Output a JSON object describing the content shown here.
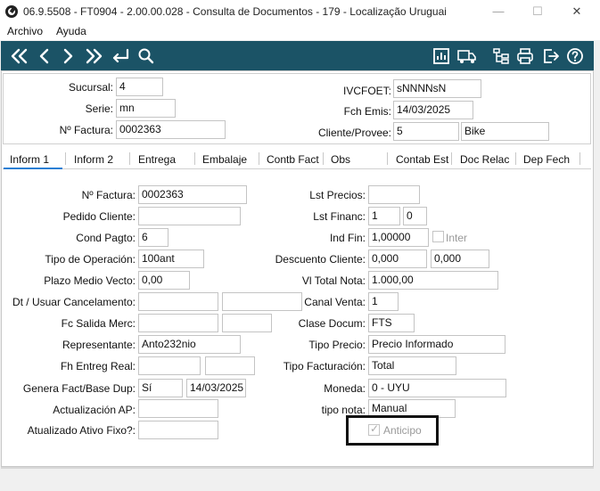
{
  "window": {
    "title": "06.9.5508 - FT0904 - 2.00.00.028 - Consulta de Documentos - 179 - Localização Uruguai",
    "minimize_glyph": "—",
    "maximize_glyph": "☐",
    "close_glyph": "✕"
  },
  "menu": {
    "items": [
      "Archivo",
      "Ayuda"
    ]
  },
  "toolbar": {
    "left_icons": [
      "first-record-icon",
      "previous-record-icon",
      "next-record-icon",
      "last-record-icon",
      "return-icon",
      "search-icon"
    ],
    "right_icons": [
      "report-icon",
      "delivery-truck-icon",
      "tree-structure-icon",
      "print-icon",
      "exit-icon",
      "help-icon"
    ]
  },
  "header": {
    "sucursal_label": "Sucursal:",
    "sucursal_value": "4",
    "serie_label": "Serie:",
    "serie_value": "mn",
    "nfactura_label": "Nº Factura:",
    "nfactura_value": "0002363",
    "ivcfoet_label": "IVCFOET:",
    "ivcfoet_value": "sNNNNsN",
    "fch_emis_label": "Fch Emis:",
    "fch_emis_value": "14/03/2025",
    "cliente_label": "Cliente/Provee:",
    "cliente_code": "5",
    "cliente_name": "Bike"
  },
  "tabs": [
    "Inform 1",
    "Inform 2",
    "Entrega",
    "Embalaje",
    "Contb Fact",
    "Obs",
    "Contab Est",
    "Doc Relac",
    "Dep Fech"
  ],
  "form": {
    "nfactura_label": "Nº Factura:",
    "nfactura_value": "0002363",
    "pedido_cliente_label": "Pedido Cliente:",
    "pedido_cliente_value": "",
    "cond_pagto_label": "Cond Pagto:",
    "cond_pagto_value": "6",
    "tipo_operacion_label": "Tipo de Operación:",
    "tipo_operacion_value": "100ant",
    "plazo_medio_label": "Plazo Medio Vecto:",
    "plazo_medio_value": "0,00",
    "dt_usuar_label": "Dt / Usuar Cancelamento:",
    "dt_usuar_value1": "",
    "dt_usuar_value2": "",
    "fc_salida_label": "Fc Salida Merc:",
    "fc_salida_value1": "",
    "fc_salida_value2": "",
    "representante_label": "Representante:",
    "representante_value": "Anto232nio",
    "fh_entreg_label": "Fh Entreg Real:",
    "fh_entreg_value1": "",
    "fh_entreg_value2": "",
    "genera_fact_label": "Genera Fact/Base Dup:",
    "genera_fact_value": "Sí",
    "genera_fact_date": "14/03/2025",
    "actualizacion_ap_label": "Actualización AP:",
    "actualizacion_ap_value": "",
    "actualizado_af_label": "Atualizado Ativo Fixo?:",
    "actualizado_af_value": "",
    "lst_precios_label": "Lst Precios:",
    "lst_precios_value": "",
    "lst_financ_label": "Lst Financ:",
    "lst_financ_value1": "1",
    "lst_financ_value2": "0",
    "ind_fin_label": "Ind Fin:",
    "ind_fin_value": "1,00000",
    "inter_label": "Inter",
    "descuento_label": "Descuento Cliente:",
    "descuento_value1": "0,000",
    "descuento_value2": "0,000",
    "vl_total_label": "Vl Total Nota:",
    "vl_total_value": "1.000,00",
    "canal_venta_label": "Canal Venta:",
    "canal_venta_value": "1",
    "clase_docum_label": "Clase Docum:",
    "clase_docum_value": "FTS",
    "tipo_precio_label": "Tipo Precio:",
    "tipo_precio_value": "Precio Informado",
    "tipo_facturacion_label": "Tipo Facturación:",
    "tipo_facturacion_value": "Total",
    "moneda_label": "Moneda:",
    "moneda_value": "0 - UYU",
    "tipo_nota_label": "tipo nota:",
    "tipo_nota_value": "Manual",
    "anticipo_label": "Anticipo"
  }
}
